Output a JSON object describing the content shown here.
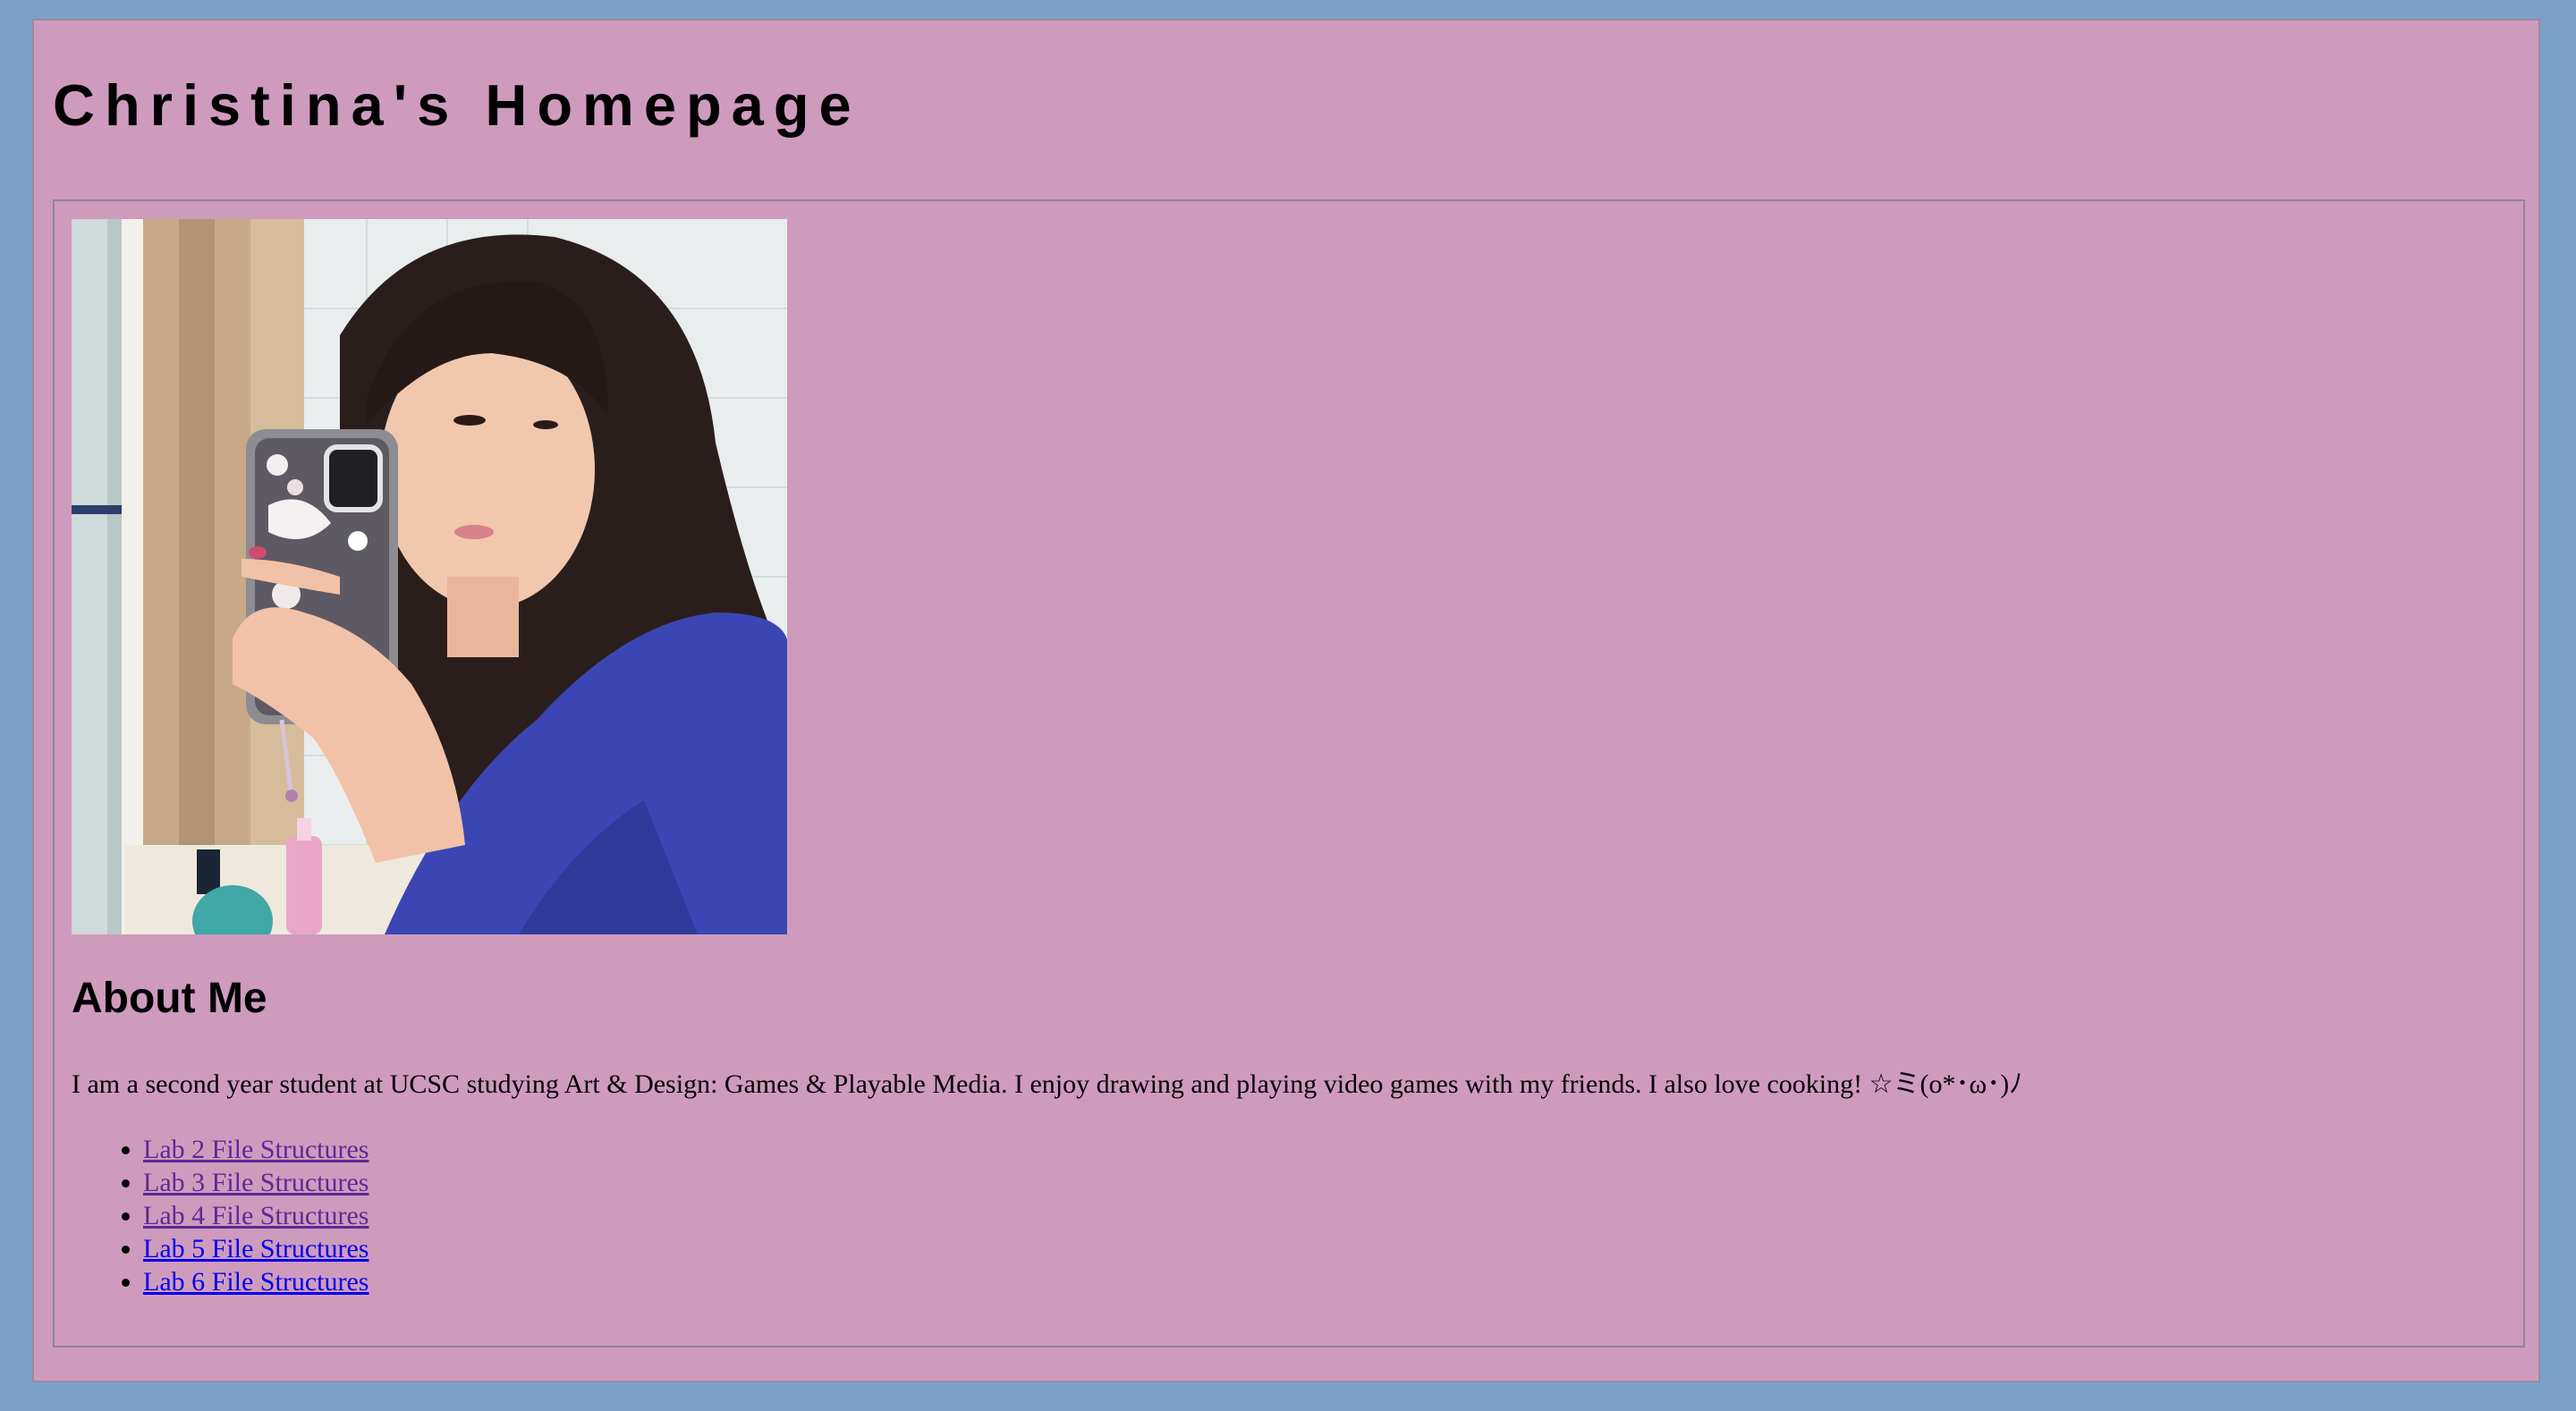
{
  "header": {
    "title": "Christina's Homepage"
  },
  "photo": {
    "description_icon": "profile-photo"
  },
  "about": {
    "heading": "About Me",
    "text": "I am a second year student at UCSC studying Art & Design: Games & Playable Media. I enjoy drawing and playing video games with my friends. I also love cooking! ☆ミ(o*･ω･)ﾉ"
  },
  "links": [
    {
      "label": "Lab 2 File Structures",
      "state": "visited"
    },
    {
      "label": "Lab 3 File Structures",
      "state": "visited"
    },
    {
      "label": "Lab 4 File Structures",
      "state": "visited"
    },
    {
      "label": "Lab 5 File Structures",
      "state": "unvisited"
    },
    {
      "label": "Lab 6 File Structures",
      "state": "unvisited"
    }
  ],
  "colors": {
    "outer_background": "#7aa1c9",
    "page_background": "#cf9bbd",
    "visited_link": "#5c2a96",
    "unvisited_link": "#0000ee"
  }
}
